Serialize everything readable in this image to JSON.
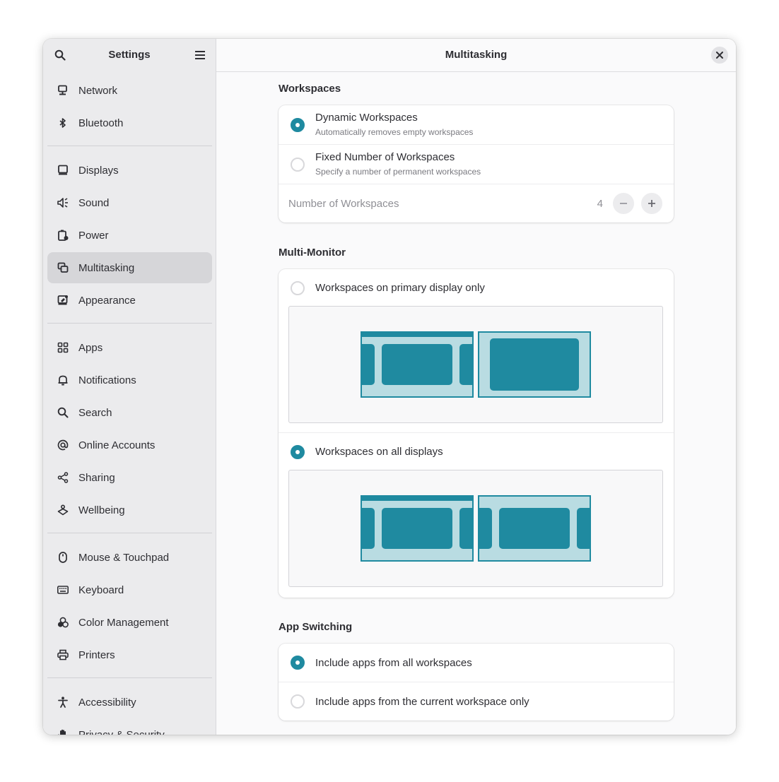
{
  "sidebar": {
    "title": "Settings",
    "groups": [
      [
        {
          "label": "Network",
          "icon": "network-icon"
        },
        {
          "label": "Bluetooth",
          "icon": "bluetooth-icon"
        }
      ],
      [
        {
          "label": "Displays",
          "icon": "display-icon"
        },
        {
          "label": "Sound",
          "icon": "speaker-icon"
        },
        {
          "label": "Power",
          "icon": "battery-icon"
        },
        {
          "label": "Multitasking",
          "icon": "multitasking-icon",
          "active": true
        },
        {
          "label": "Appearance",
          "icon": "appearance-icon"
        }
      ],
      [
        {
          "label": "Apps",
          "icon": "apps-grid-icon"
        },
        {
          "label": "Notifications",
          "icon": "bell-icon"
        },
        {
          "label": "Search",
          "icon": "search-icon"
        },
        {
          "label": "Online Accounts",
          "icon": "at-sign-icon"
        },
        {
          "label": "Sharing",
          "icon": "share-icon"
        },
        {
          "label": "Wellbeing",
          "icon": "wellbeing-icon"
        }
      ],
      [
        {
          "label": "Mouse & Touchpad",
          "icon": "mouse-icon"
        },
        {
          "label": "Keyboard",
          "icon": "keyboard-icon"
        },
        {
          "label": "Color Management",
          "icon": "color-management-icon"
        },
        {
          "label": "Printers",
          "icon": "printer-icon"
        }
      ],
      [
        {
          "label": "Accessibility",
          "icon": "accessibility-icon"
        },
        {
          "label": "Privacy & Security",
          "icon": "hand-icon"
        }
      ]
    ]
  },
  "main": {
    "title": "Multitasking",
    "workspaces": {
      "heading": "Workspaces",
      "dynamic": {
        "title": "Dynamic Workspaces",
        "subtitle": "Automatically removes empty workspaces",
        "selected": true
      },
      "fixed": {
        "title": "Fixed Number of Workspaces",
        "subtitle": "Specify a number of permanent workspaces",
        "selected": false
      },
      "number": {
        "label": "Number of Workspaces",
        "value": "4"
      }
    },
    "multi_monitor": {
      "heading": "Multi-Monitor",
      "primary_only": {
        "title": "Workspaces on primary display only",
        "selected": false
      },
      "all_displays": {
        "title": "Workspaces on all displays",
        "selected": true
      }
    },
    "app_switching": {
      "heading": "App Switching",
      "all_workspaces": {
        "title": "Include apps from all workspaces",
        "selected": true
      },
      "current_only": {
        "title": "Include apps from the current workspace only",
        "selected": false
      }
    }
  },
  "colors": {
    "accent": "#1f8aa0",
    "accent_light": "#b9dce2",
    "sidebar_bg": "#ebebed",
    "active_item_bg": "#d6d6d9"
  }
}
